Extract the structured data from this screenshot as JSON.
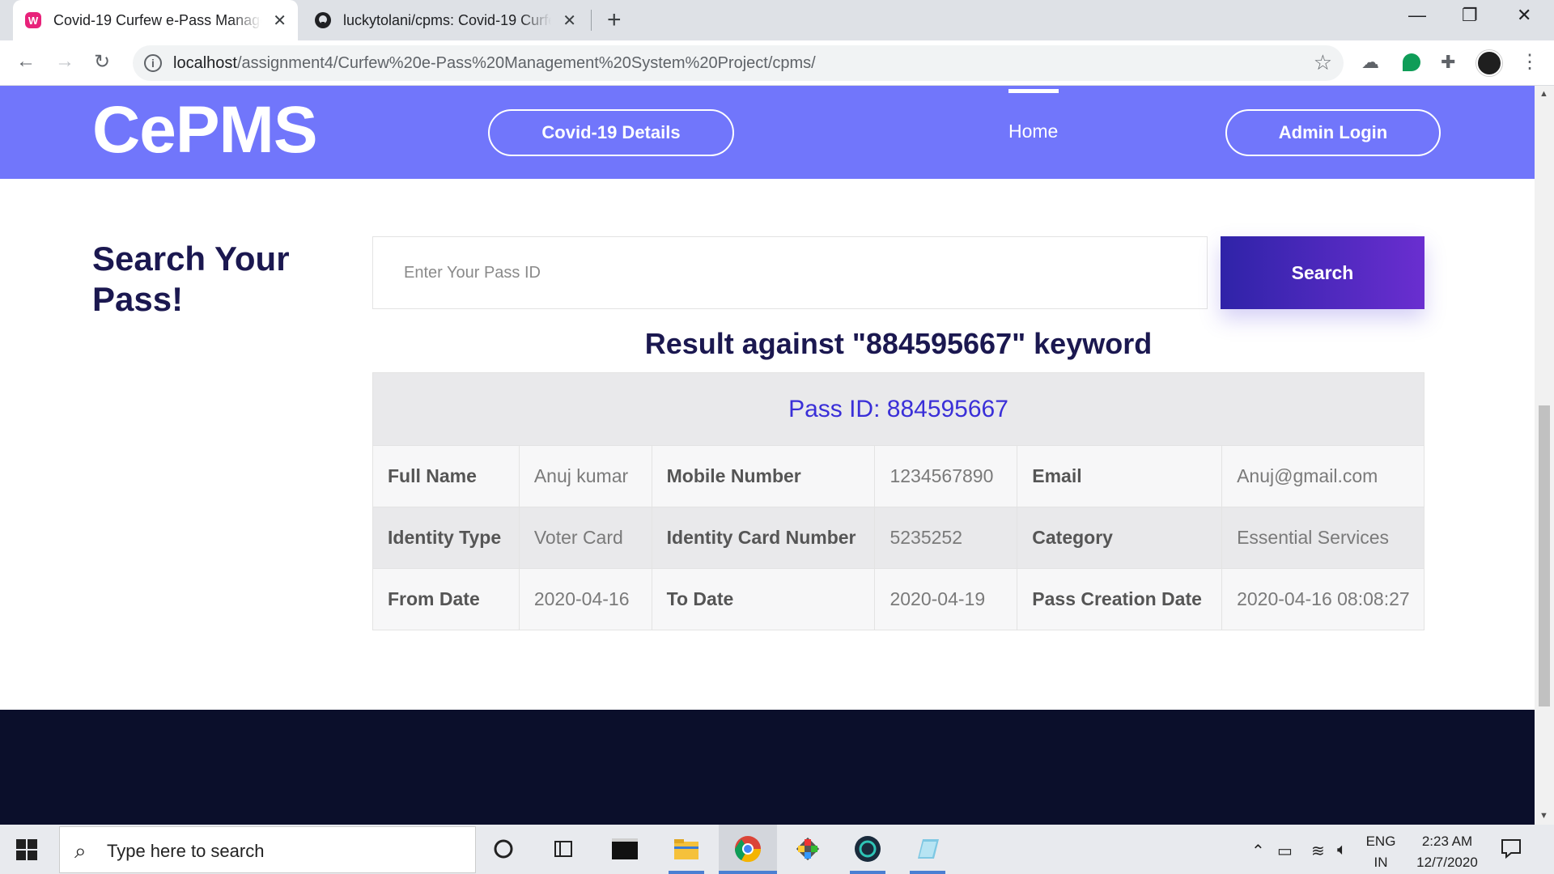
{
  "browser": {
    "tabs": [
      {
        "title": "Covid-19 Curfew e-Pass Management",
        "active": true
      },
      {
        "title": "luckytolani/cpms: Covid-19 Curfew e-Pass",
        "active": false
      }
    ],
    "url_host": "localhost",
    "url_path": "/assignment4/Curfew%20e-Pass%20Management%20System%20Project/cpms/"
  },
  "site": {
    "logo": "CePMS",
    "nav": {
      "covid_details": "Covid-19 Details",
      "home": "Home",
      "admin_login": "Admin Login"
    }
  },
  "search": {
    "title": "Search Your Pass!",
    "placeholder": "Enter Your Pass ID",
    "button": "Search"
  },
  "result": {
    "heading": "Result against \"884595667\" keyword",
    "pass_id": "Pass ID: 884595667",
    "rows": [
      [
        {
          "label": "Full Name",
          "value": "Anuj kumar"
        },
        {
          "label": "Mobile Number",
          "value": "1234567890"
        },
        {
          "label": "Email",
          "value": "Anuj@gmail.com"
        }
      ],
      [
        {
          "label": "Identity Type",
          "value": "Voter Card"
        },
        {
          "label": "Identity Card Number",
          "value": "5235252"
        },
        {
          "label": "Category",
          "value": "Essential Services"
        }
      ],
      [
        {
          "label": "From Date",
          "value": "2020-04-16"
        },
        {
          "label": "To Date",
          "value": "2020-04-19"
        },
        {
          "label": "Pass Creation Date",
          "value": "2020-04-16 08:08:27"
        }
      ]
    ]
  },
  "taskbar": {
    "search_text": "Type here to search",
    "lang_top": "ENG",
    "lang_bottom": "IN",
    "time": "2:23 AM",
    "date": "12/7/2020"
  },
  "colors": {
    "header_bg": "#7176fb",
    "heading_text": "#1b1850",
    "pass_id_text": "#3a2fd8",
    "footer_bg": "#0b0f2b",
    "search_btn_from": "#2f23a8",
    "search_btn_to": "#6a2ed0"
  }
}
